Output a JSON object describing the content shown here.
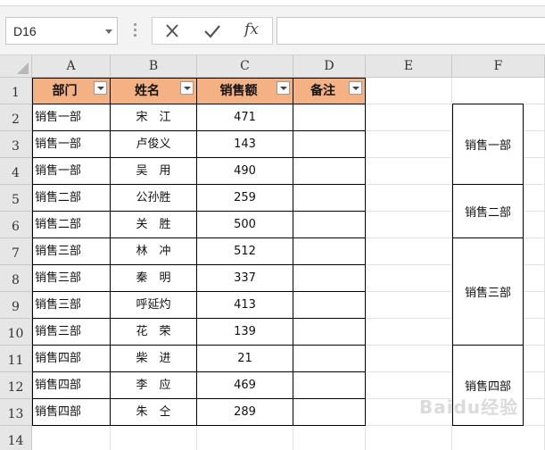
{
  "name_box": "D16",
  "formula_text": "",
  "fx_label": "fx",
  "columns": [
    "A",
    "B",
    "C",
    "D",
    "E",
    "F"
  ],
  "rows": [
    "1",
    "2",
    "3",
    "4",
    "5",
    "6",
    "7",
    "8",
    "9",
    "10",
    "11",
    "12",
    "13",
    "14"
  ],
  "headers": {
    "dept": "部门",
    "name": "姓名",
    "sales": "销售额",
    "note": "备注"
  },
  "table": [
    {
      "dept": "销售一部",
      "name": "宋　江",
      "sales": "471"
    },
    {
      "dept": "销售一部",
      "name": "卢俊义",
      "sales": "143"
    },
    {
      "dept": "销售一部",
      "name": "吴　用",
      "sales": "490"
    },
    {
      "dept": "销售二部",
      "name": "公孙胜",
      "sales": "259"
    },
    {
      "dept": "销售二部",
      "name": "关　胜",
      "sales": "500"
    },
    {
      "dept": "销售三部",
      "name": "林　冲",
      "sales": "512"
    },
    {
      "dept": "销售三部",
      "name": "秦　明",
      "sales": "337"
    },
    {
      "dept": "销售三部",
      "name": "呼延灼",
      "sales": "413"
    },
    {
      "dept": "销售三部",
      "name": "花　荣",
      "sales": "139"
    },
    {
      "dept": "销售四部",
      "name": "柴　进",
      "sales": "21"
    },
    {
      "dept": "销售四部",
      "name": "李　应",
      "sales": "469"
    },
    {
      "dept": "销售四部",
      "name": "朱　仝",
      "sales": "289"
    }
  ],
  "merged_f": [
    "销售一部",
    "销售二部",
    "销售三部",
    "销售四部"
  ],
  "watermark": "Baidu经验",
  "colors": {
    "header_fill": "#f4b183"
  }
}
